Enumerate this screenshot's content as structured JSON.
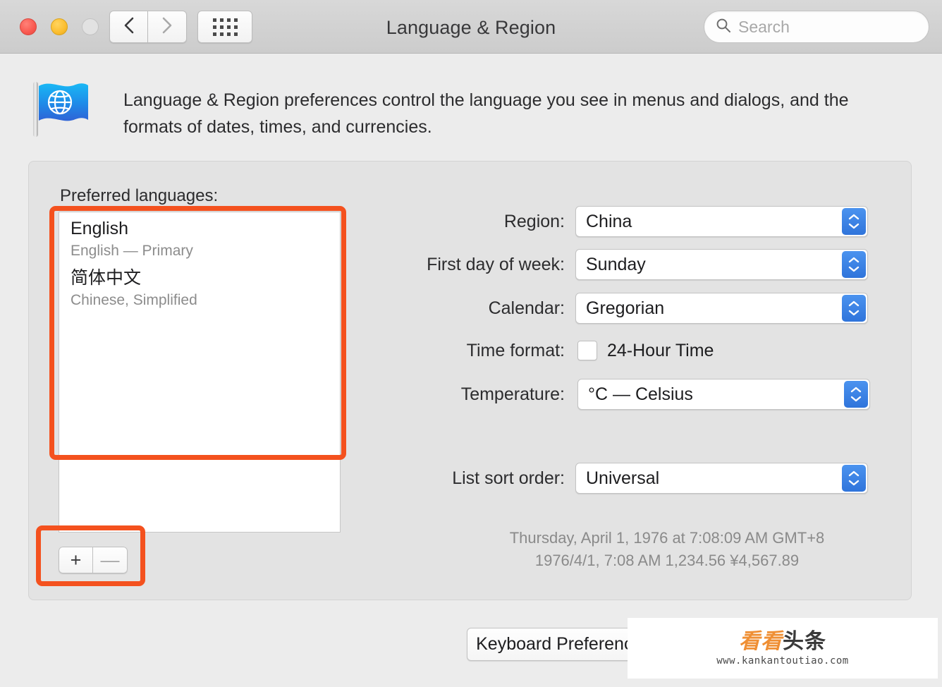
{
  "window": {
    "title": "Language & Region",
    "traffic_lights": [
      {
        "name": "close",
        "color": "#f9584f"
      },
      {
        "name": "minimize",
        "color": "#fbbd2e"
      },
      {
        "name": "zoom",
        "color": "#e2e2e2"
      }
    ],
    "nav": {
      "back_icon": "chevron-left-icon",
      "forward_icon": "chevron-right-icon",
      "grid_icon": "show-all-grid-icon"
    },
    "search": {
      "placeholder": "Search",
      "value": "",
      "icon": "search-icon"
    }
  },
  "header": {
    "icon": "flag-globe-icon",
    "description": "Language & Region preferences control the language you see in menus and dialogs, and the formats of dates, times, and currencies."
  },
  "panel": {
    "preferred_languages_label": "Preferred languages:",
    "languages": [
      {
        "name": "English",
        "subtitle": "English — Primary"
      },
      {
        "name": "简体中文",
        "subtitle": "Chinese, Simplified"
      }
    ],
    "add_button": "+",
    "remove_button": "—"
  },
  "form": {
    "rows": [
      {
        "label": "Region:",
        "value": "China",
        "type": "popup"
      },
      {
        "label": "First day of week:",
        "value": "Sunday",
        "type": "popup"
      },
      {
        "label": "Calendar:",
        "value": "Gregorian",
        "type": "popup"
      },
      {
        "label": "Time format:",
        "value": "24-Hour Time",
        "type": "checkbox",
        "checked": false
      },
      {
        "label": "Temperature:",
        "value": "°C — Celsius",
        "type": "popup"
      },
      {
        "label": "List sort order:",
        "value": "Universal",
        "type": "popup"
      }
    ],
    "preview_line1": "Thursday, April 1, 1976 at 7:08:09 AM GMT+8",
    "preview_line2": "1976/4/1, 7:08 AM     1,234.56     ¥4,567.89"
  },
  "footer": {
    "keyboard_button": "Keyboard Preferences…"
  },
  "annotations": {
    "color": "#f4511e",
    "highlight_language_list": "preferred-languages-list",
    "highlight_add_remove": "add-remove-language-buttons"
  },
  "watermark": {
    "brand_orange": "看看",
    "brand_dark": "头条",
    "url": "www.kankantoutiao.com"
  }
}
